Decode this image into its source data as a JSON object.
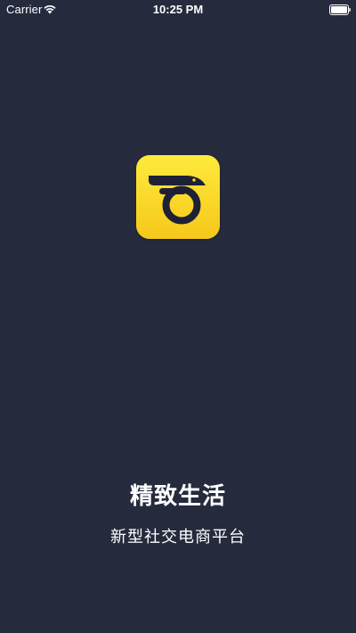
{
  "status_bar": {
    "carrier": "Carrier",
    "time": "10:25 PM",
    "wifi_icon": "wifi-icon",
    "battery_icon": "battery-icon"
  },
  "app": {
    "logo_icon": "app-logo-icon",
    "background_color": "#252a3d",
    "logo_color": "#f9d82a",
    "logo_mark_color": "#1e2136"
  },
  "splash": {
    "title": "精致生活",
    "subtitle": "新型社交电商平台"
  }
}
